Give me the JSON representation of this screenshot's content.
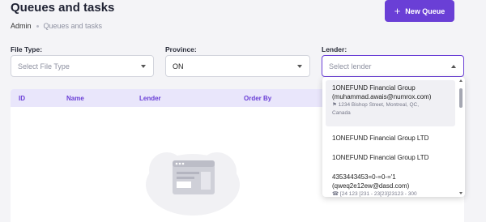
{
  "header": {
    "title": "Queues and tasks",
    "breadcrumb": {
      "root": "Admin",
      "current": "Queues and tasks"
    },
    "new_queue_label": "New Queue"
  },
  "filters": {
    "file_type": {
      "label": "File Type:",
      "placeholder": "Select File Type",
      "value": ""
    },
    "province": {
      "label": "Province:",
      "value": "ON"
    },
    "lender": {
      "label": "Lender:",
      "placeholder": "Select lender",
      "value": ""
    }
  },
  "table": {
    "columns": [
      "ID",
      "Name",
      "Lender",
      "Order By"
    ]
  },
  "lender_dropdown": {
    "items": [
      {
        "line1": "1ONEFUND Financial Group",
        "line2": "(muhammad.awais@numrox.com)",
        "address1": "1234 Bishop Street, Montreal, QC,",
        "address2": "Canada"
      },
      {
        "line1": "1ONEFUND Financial Group LTD"
      },
      {
        "line1": "1ONEFUND Financial Group LTD"
      },
      {
        "line1": "4353443453=0-=0-='1",
        "line2": "(qweq2e12ew@dasd.com)",
        "address1": "[24 123 [231 -  23[23]23123 -  300"
      }
    ]
  },
  "icons": {
    "new_queue": "plus-icon",
    "lender_address": "location-pin-icon",
    "lender_phone": "phone-icon",
    "empty_state": "browser-window-illustration"
  },
  "colors": {
    "accent": "#6a3fd6",
    "header_bg": "#e9e6fb",
    "page_bg": "#f4f4f7"
  }
}
